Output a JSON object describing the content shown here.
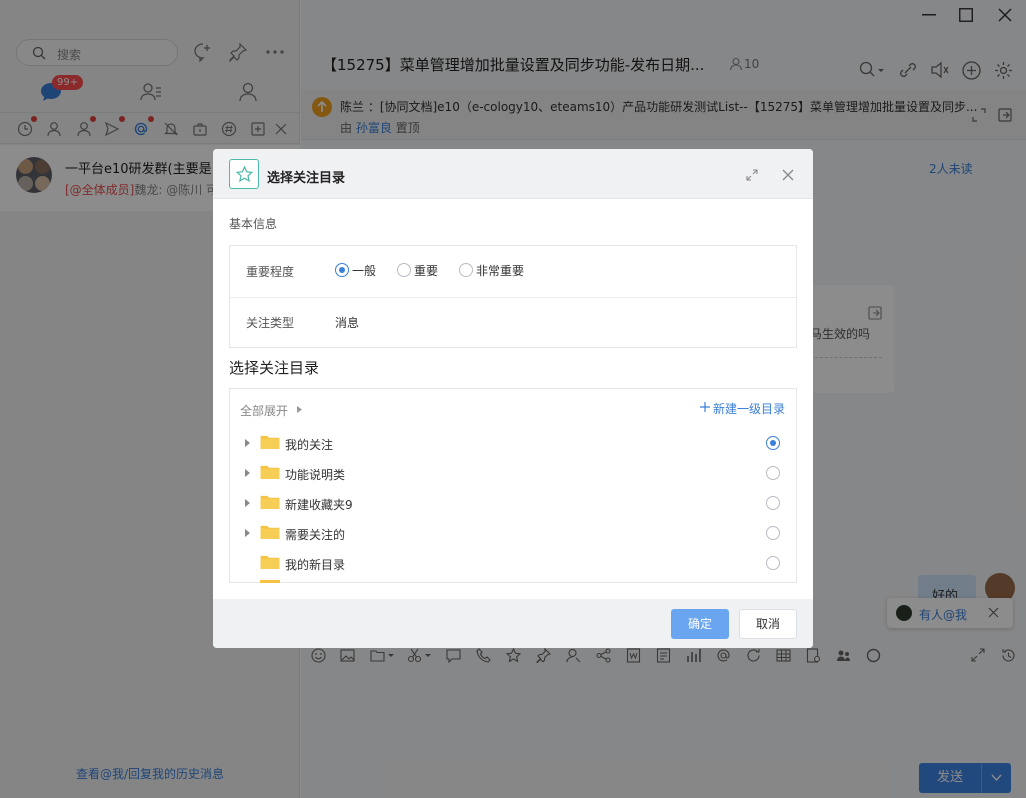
{
  "left": {
    "search_placeholder": "搜索",
    "chat_badge": "99+",
    "conversation": {
      "name": "一平台e10研发群(主要是",
      "at_tag": "[@全体成员]",
      "preview": "魏龙: @陈川 可"
    },
    "history_link": "查看@我/回复我的历史消息"
  },
  "chat": {
    "title": "【15275】菜单管理增加批量设置及同步功能-发布日期...",
    "member_count": "10",
    "pin": {
      "text": "陈兰 ：[协同文档]e10（e-cology10、eteams10）产品功能研发测试List--【15275】菜单管理增加批量设置及同步...",
      "by_prefix": "由",
      "by_name": "孙富良",
      "by_suffix": "置顶"
    },
    "unread": "2人未读",
    "card_text": "马生效的吗",
    "bubble_text": "好的",
    "at_toast": "有人@我",
    "send": "发送"
  },
  "modal": {
    "title": "选择关注目录",
    "basic_section": "基本信息",
    "importance_label": "重要程度",
    "importance_options": [
      "一般",
      "重要",
      "非常重要"
    ],
    "importance_selected": "一般",
    "type_label": "关注类型",
    "type_value": "消息",
    "dir_section": "选择关注目录",
    "expand_all": "全部展开",
    "new_dir": "新建一级目录",
    "folders": [
      "我的关注",
      "功能说明类",
      "新建收藏夹9",
      "需要关注的",
      "我的新目录"
    ],
    "selected_folder": "我的关注",
    "ok": "确定",
    "cancel": "取消"
  },
  "colors": {
    "accent": "#3a7fd9",
    "primary_button": "#6aa6ef",
    "folder": "#f5c242",
    "badge": "#ff4d4f"
  }
}
